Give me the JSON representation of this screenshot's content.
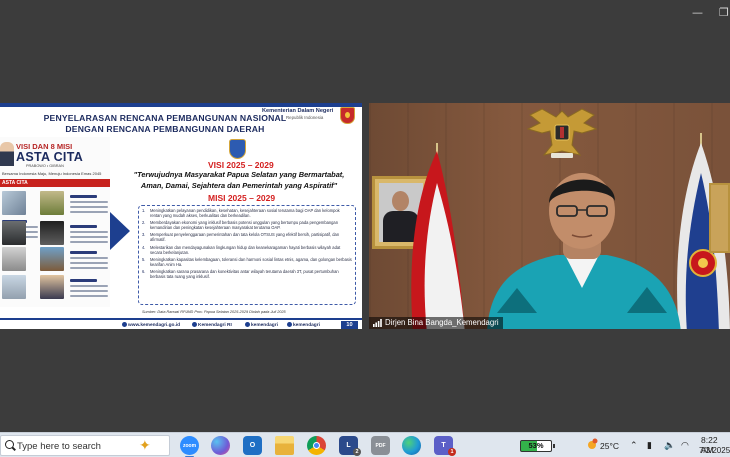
{
  "window": {
    "min_glyph": "—",
    "restore_glyph": "❐"
  },
  "slide": {
    "title": "PENYELARASAN RENCANA PEMBANGUNAN NASIONAL DENGAN RENCANA PEMBANGUNAN DAERAH",
    "ministry": "Kementerian Dalam Negeri",
    "ministry_sub": "Republik Indonesia",
    "brochure": {
      "visi_misi": "VISI DAN 8 MISI",
      "asta_cita": "ASTA CITA",
      "candidates": "PRABOWO • GIBRAN",
      "vision_line": "Bersama Indonesia Maju, Menuju Indonesia Emas 2045",
      "section_label": "ASTA CITA"
    },
    "visi_head": "VISI 2025 – 2029",
    "visi_text": "\"Terwujudnya Masyarakat Papua Selatan yang Bermartabat, Aman, Damai, Sejahtera dan Pemerintah yang Aspiratif\"",
    "misi_head": "MISI 2025 – 2029",
    "misi": [
      {
        "n": "1.",
        "text": "Meningkatkan pelayanan pendidikan, kesehatan, kesejahteraan sosial terutama bagi OAP dan kelompok rentan yang mudah akses, berkualitas dan berkeadilan."
      },
      {
        "n": "2.",
        "text": "Memberdayakan ekonomi yang inklusif berbasis potensi unggulan yang bertumpu pada pengembangan kemandirian dan peningkatan kesejahteraan masyarakat terutama OAP."
      },
      {
        "n": "3.",
        "text": "Memperkuat penyelenggaraan pemerintahan dan tata kelola OTSUS yang efektif bersih, partisipatif, dan afirmatif."
      },
      {
        "n": "4.",
        "text": "Melestarikan dan mendayagunakan lingkungan hidup dan keanekaragaman hayati berbasis wilayah adat secara berkelanjutan."
      },
      {
        "n": "5.",
        "text": "Meningkatkan kapasitas kelembagaan, toleransi dan harmoni sosial lintas etnis, agama, dan golongan berbasis kearifan Anim Ha."
      },
      {
        "n": "6.",
        "text": "Meningkatkan sarana prasarana dan konektivitas antar wilayah terutama daerah 3T, pusat pertumbuhan berbasis tata ruang yang inklusif."
      }
    ],
    "source": "Sumber: Data Ranwal RPJMD Prov. Papua Selatan 2025-2029 Diolah pada Juli 2025",
    "footer": {
      "website": "www.kemendagri.go.id",
      "facebook": "Kemendagri RI",
      "twitter": "kemendagri",
      "instagram": "kemendagri"
    },
    "page_number": "10"
  },
  "camera": {
    "participant_name": "Dirjen Bina Bangda_Kemendagri"
  },
  "taskbar": {
    "search_placeholder": "Type here to search",
    "apps": [
      {
        "name": "zoom",
        "label": "zoom",
        "color": "#2d8cff"
      },
      {
        "name": "copilot",
        "label": "",
        "color": "#6f5bd6"
      },
      {
        "name": "outlook",
        "label": "O",
        "color": "#1f6fc4"
      },
      {
        "name": "file-explorer",
        "label": "",
        "color": "#f2c14e"
      },
      {
        "name": "chrome",
        "label": "",
        "color": "#ffffff"
      },
      {
        "name": "app-l",
        "label": "L",
        "color": "#2b4a8b",
        "badge": "2"
      },
      {
        "name": "pdf-app",
        "label": "PDF",
        "color": "#8a8f96"
      },
      {
        "name": "edge",
        "label": "",
        "color": "#1f9ad6"
      },
      {
        "name": "teams",
        "label": "T",
        "color": "#5b5fc7",
        "badge": "1"
      }
    ],
    "battery": "53%",
    "temperature": "25°C",
    "time": "8:22 AM",
    "date": "7/3/2025"
  }
}
